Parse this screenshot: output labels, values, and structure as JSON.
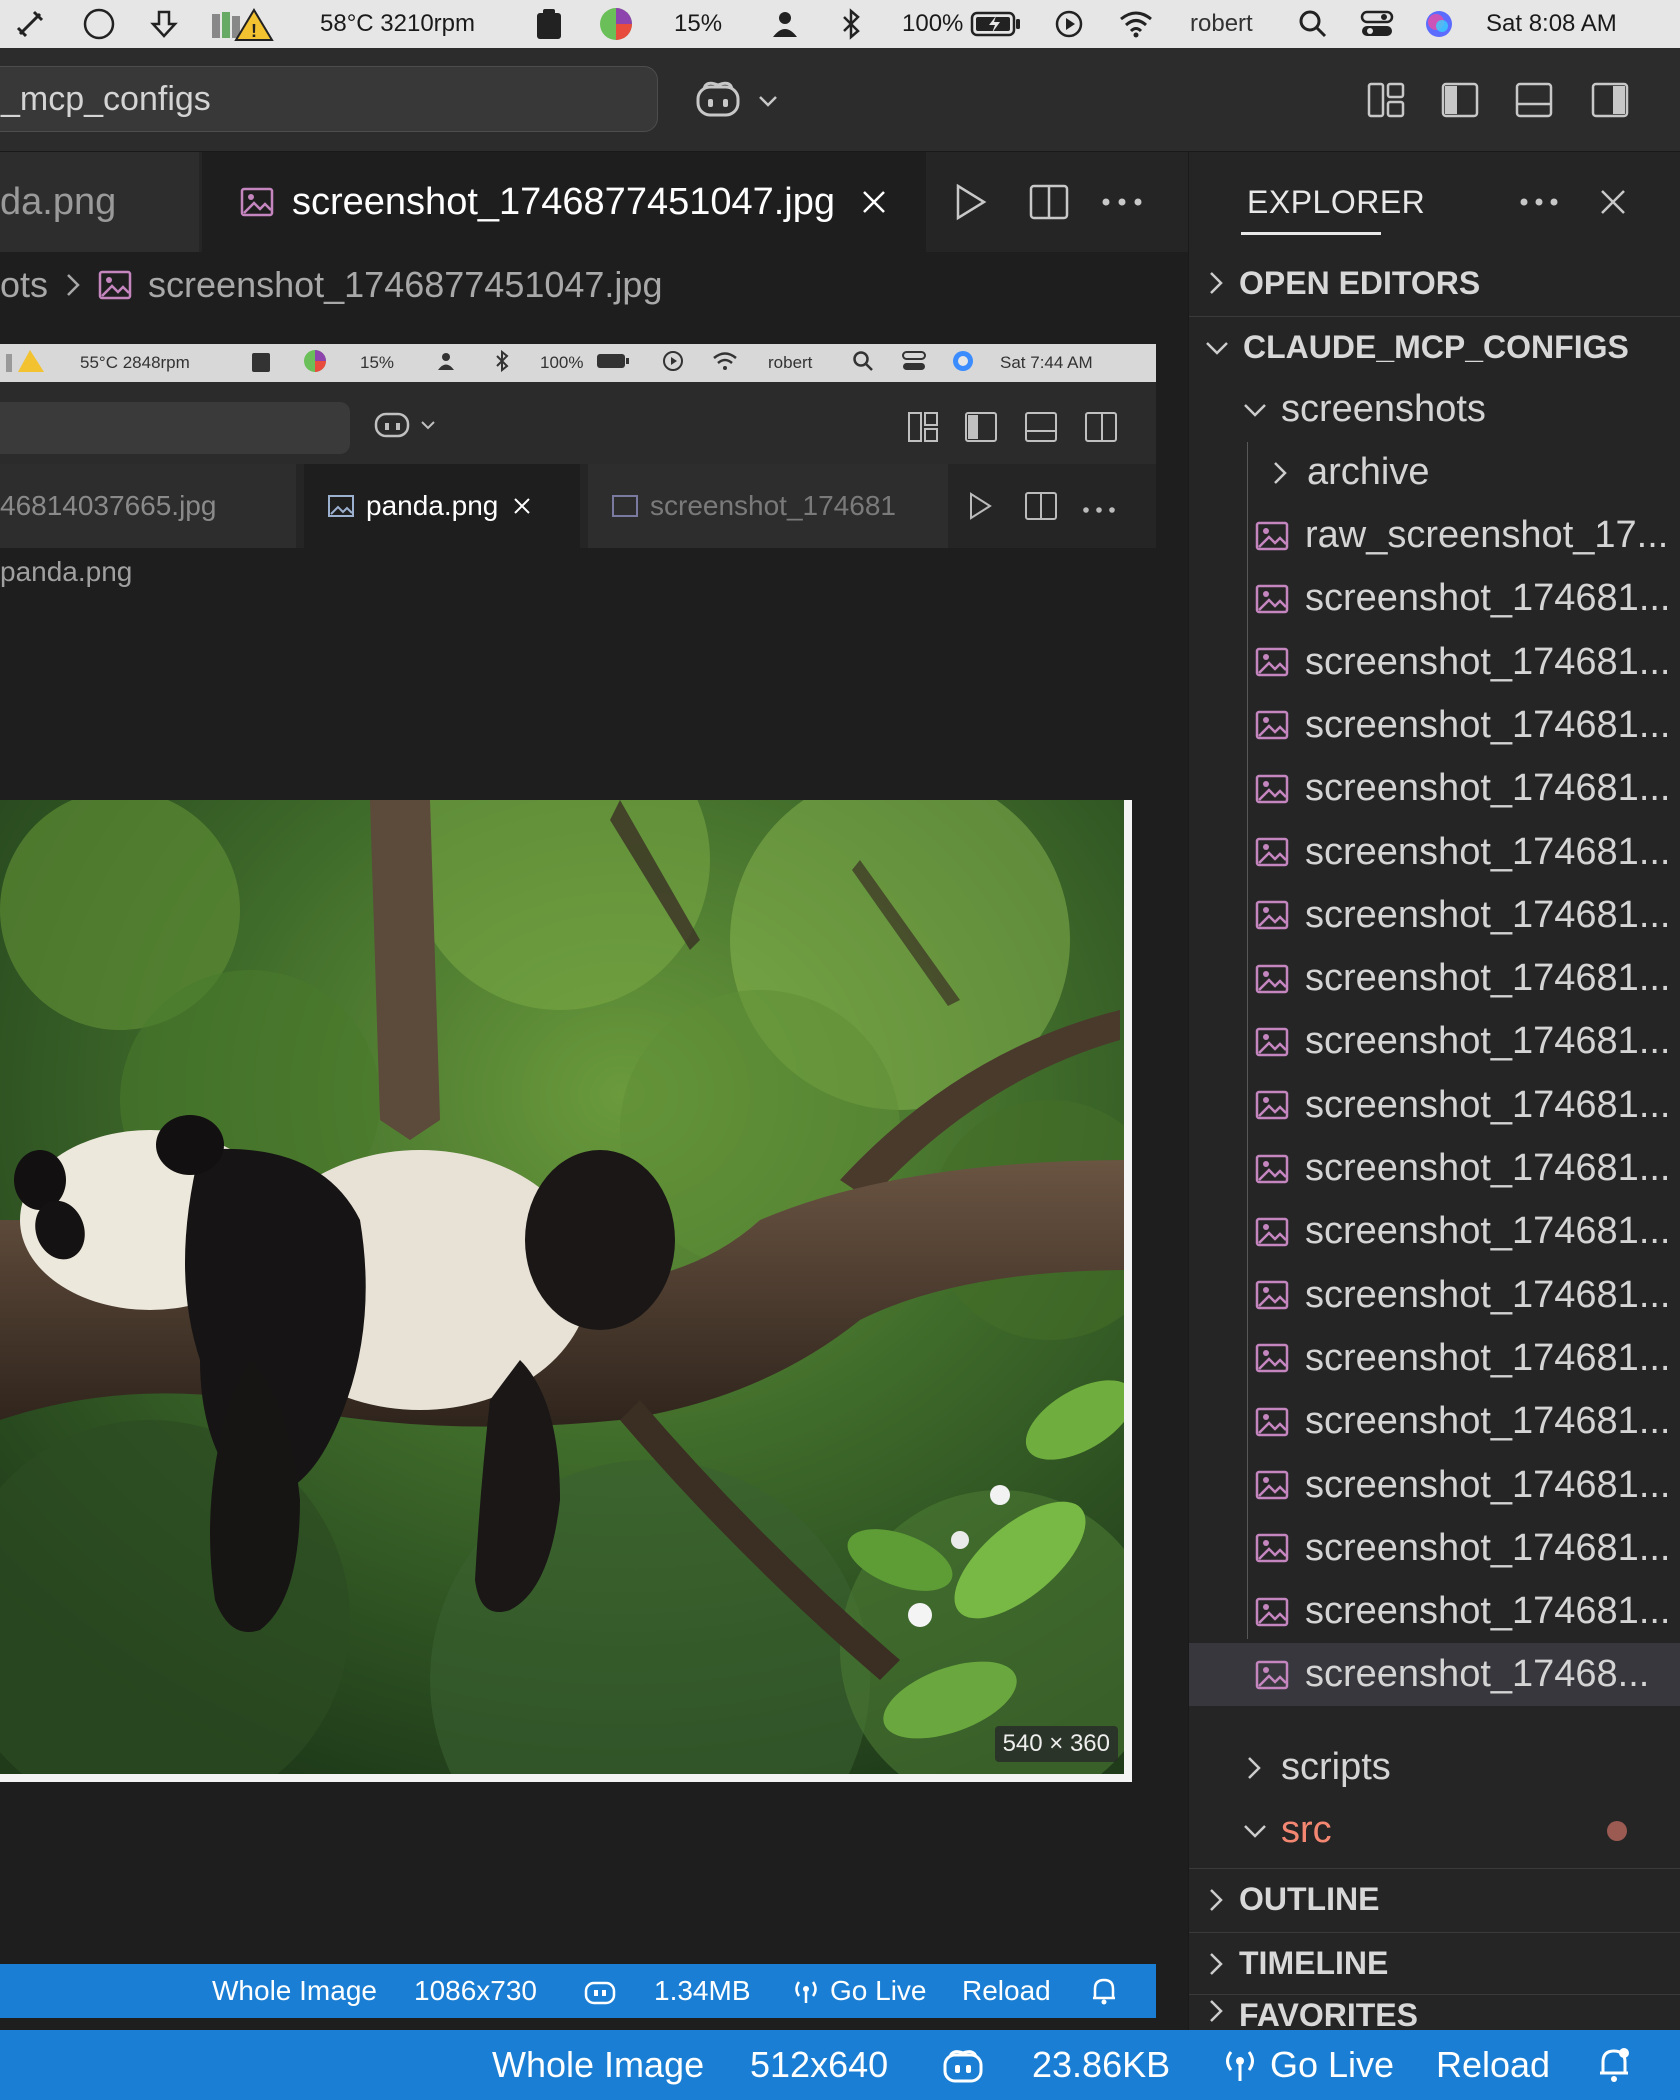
{
  "menubar": {
    "temperature": "58°C 3210rpm",
    "cpu": "15%",
    "battery": "100%",
    "user": "robert",
    "clock": "Sat  8:08 AM"
  },
  "titlebar": {
    "search_text": "_mcp_configs"
  },
  "tabs": [
    {
      "label": "da.png",
      "active": false
    },
    {
      "label": "screenshot_1746877451047.jpg",
      "active": true
    }
  ],
  "breadcrumb": {
    "folder": "ots",
    "file": "screenshot_1746877451047.jpg"
  },
  "nested": {
    "menubar": {
      "temperature": "55°C 2848rpm",
      "cpu": "15%",
      "battery": "100%",
      "user": "robert",
      "clock": "Sat  7:44 AM"
    },
    "tabs": [
      {
        "label": "46814037665.jpg"
      },
      {
        "label": "panda.png"
      },
      {
        "label": "screenshot_174681"
      }
    ],
    "breadcrumb": "panda.png",
    "dimensions_badge": "540 × 360",
    "statusbar": {
      "whole_image": "Whole Image",
      "size": "1086x730",
      "filesize": "1.34MB",
      "golive": "Go Live",
      "reload": "Reload"
    }
  },
  "explorer": {
    "title": "EXPLORER",
    "open_editors": "OPEN EDITORS",
    "root": "CLAUDE_MCP_CONFIGS",
    "folders": {
      "screenshots": "screenshots",
      "archive": "archive",
      "scripts": "scripts",
      "src": "src"
    },
    "files": [
      "raw_screenshot_17...",
      "screenshot_174681...",
      "screenshot_174681...",
      "screenshot_174681...",
      "screenshot_174681...",
      "screenshot_174681...",
      "screenshot_174681...",
      "screenshot_174681...",
      "screenshot_174681...",
      "screenshot_174681...",
      "screenshot_174681...",
      "screenshot_174681...",
      "screenshot_174681...",
      "screenshot_174681...",
      "screenshot_174681...",
      "screenshot_174681...",
      "screenshot_174681...",
      "screenshot_174681...",
      "screenshot_17468..."
    ],
    "outline": "OUTLINE",
    "timeline": "TIMELINE",
    "favorites": "FAVORITES"
  },
  "statusbar": {
    "whole_image": "Whole Image",
    "size": "512x640",
    "filesize": "23.86KB",
    "golive": "Go Live",
    "reload": "Reload"
  },
  "colors": {
    "accent": "#1a7fd4",
    "image_icon": "#c586c0",
    "src_folder": "#f48771",
    "modified_dot": "#9b5a52"
  }
}
